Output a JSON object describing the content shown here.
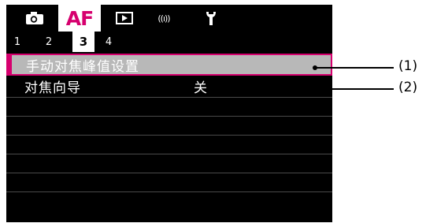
{
  "tabs": [
    {
      "icon": "camera-icon",
      "active": false
    },
    {
      "label": "AF",
      "active": true
    },
    {
      "icon": "playback-icon",
      "active": false
    },
    {
      "icon": "wireless-icon",
      "label": "((ı))",
      "active": false
    },
    {
      "icon": "wrench-icon",
      "active": false
    }
  ],
  "subtabs": [
    "1",
    "2",
    "3",
    "4"
  ],
  "active_subtab": "3",
  "menu": {
    "items": [
      {
        "label": "手动对焦峰值设置",
        "value": "",
        "selected": true
      },
      {
        "label": "对焦向导",
        "value": "关",
        "selected": false
      }
    ]
  },
  "callouts": [
    "(1)",
    "(2)"
  ],
  "colors": {
    "accent": "#d6006e",
    "background": "#000000",
    "selected_row": "#b8b8b8"
  }
}
